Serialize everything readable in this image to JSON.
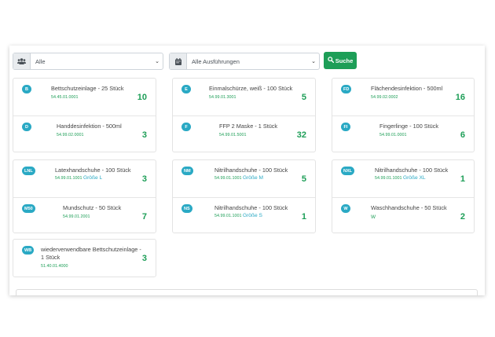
{
  "filters": {
    "group_icon": "users-icon",
    "group_value": "Alle",
    "version_icon": "calendar-icon",
    "version_value": "Alle Ausführungen",
    "search_label": "Suche",
    "search_icon": "search-icon"
  },
  "colors": {
    "accent_green": "#1d9e57",
    "badge_teal": "#2aa9c4"
  },
  "items": [
    {
      "badge": "B",
      "name": "Bettschutzeinlage - 25 Stück",
      "code": "54.45.01.0001",
      "size": "",
      "count": "10"
    },
    {
      "badge": "D",
      "name": "Handdesinfektion - 500ml",
      "code": "54.99.02.0001",
      "size": "",
      "count": "3"
    },
    {
      "badge": "E",
      "name": "Einmalschürze, weiß - 100 Stück",
      "code": "54.99.01.3001",
      "size": "",
      "count": "5"
    },
    {
      "badge": "F",
      "name": "FFP 2 Maske - 1 Stück",
      "code": "54.99.01.5001",
      "size": "",
      "count": "32"
    },
    {
      "badge": "FD",
      "name": "Flächendesinfektion - 500ml",
      "code": "54.99.02.0002",
      "size": "",
      "count": "16"
    },
    {
      "badge": "FI",
      "name": "Fingerlinge - 100 Stück",
      "code": "54.99.01.0001",
      "size": "",
      "count": "6"
    },
    {
      "badge": "LNL",
      "name": "Latexhandschuhe - 100 Stück",
      "code": "54.99.01.1001",
      "size": "Größe L",
      "count": "3"
    },
    {
      "badge": "M50",
      "name": "Mundschutz - 50 Stück",
      "code": "54.99.01.2001",
      "size": "",
      "count": "7"
    },
    {
      "badge": "NM",
      "name": "Nitrilhandschuhe - 100 Stück",
      "code": "54.99.01.1001",
      "size": "Größe M",
      "count": "5"
    },
    {
      "badge": "NS",
      "name": "Nitrilhandschuhe - 100 Stück",
      "code": "54.99.01.1001",
      "size": "Größe S",
      "count": "1"
    },
    {
      "badge": "NXL",
      "name": "Nitrilhandschuhe - 100 Stück",
      "code": "54.99.01.1001",
      "size": "Größe XL",
      "count": "1"
    },
    {
      "badge": "W",
      "name": "Waschhandschuhe - 50 Stück",
      "code": "W",
      "size": "",
      "count": "2"
    },
    {
      "badge": "WB",
      "name": "wiederverwendbare Bettschutzeinlage - 1 Stück",
      "code": "51.40.01.4000",
      "size": "",
      "count": "3"
    }
  ]
}
